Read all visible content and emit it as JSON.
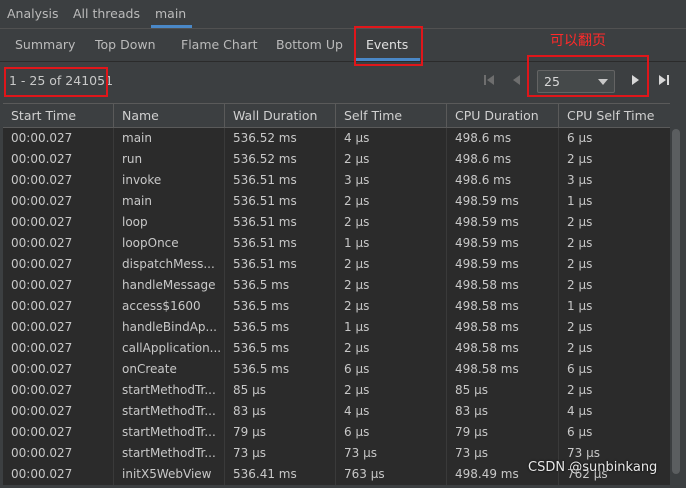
{
  "top_tabs": [
    "Analysis",
    "All threads",
    "main"
  ],
  "sub_tabs": [
    "Summary",
    "Top Down",
    "Flame Chart",
    "Bottom Up",
    "Events"
  ],
  "paging": {
    "range_label": "1 - 25 of 241051",
    "page_size": "25"
  },
  "annotation": {
    "text": "可以翻页",
    "color": "#e0161a"
  },
  "table": {
    "columns": [
      "Start Time",
      "Name",
      "Wall Duration",
      "Self Time",
      "CPU Duration",
      "CPU Self Time"
    ],
    "rows": [
      [
        "00:00.027",
        "main",
        "536.52 ms",
        "4 μs",
        "498.6 ms",
        "6 μs"
      ],
      [
        "00:00.027",
        "run",
        "536.52 ms",
        "2 μs",
        "498.6 ms",
        "2 μs"
      ],
      [
        "00:00.027",
        "invoke",
        "536.51 ms",
        "3 μs",
        "498.6 ms",
        "3 μs"
      ],
      [
        "00:00.027",
        "main",
        "536.51 ms",
        "2 μs",
        "498.59 ms",
        "1 μs"
      ],
      [
        "00:00.027",
        "loop",
        "536.51 ms",
        "2 μs",
        "498.59 ms",
        "2 μs"
      ],
      [
        "00:00.027",
        "loopOnce",
        "536.51 ms",
        "1 μs",
        "498.59 ms",
        "2 μs"
      ],
      [
        "00:00.027",
        "dispatchMess...",
        "536.51 ms",
        "2 μs",
        "498.59 ms",
        "2 μs"
      ],
      [
        "00:00.027",
        "handleMessage",
        "536.5 ms",
        "2 μs",
        "498.58 ms",
        "2 μs"
      ],
      [
        "00:00.027",
        "access$1600",
        "536.5 ms",
        "2 μs",
        "498.58 ms",
        "1 μs"
      ],
      [
        "00:00.027",
        "handleBindAp...",
        "536.5 ms",
        "1 μs",
        "498.58 ms",
        "2 μs"
      ],
      [
        "00:00.027",
        "callApplication...",
        "536.5 ms",
        "2 μs",
        "498.58 ms",
        "2 μs"
      ],
      [
        "00:00.027",
        "onCreate",
        "536.5 ms",
        "6 μs",
        "498.58 ms",
        "6 μs"
      ],
      [
        "00:00.027",
        "startMethodTr...",
        "85 μs",
        "2 μs",
        "85 μs",
        "2 μs"
      ],
      [
        "00:00.027",
        "startMethodTr...",
        "83 μs",
        "4 μs",
        "83 μs",
        "4 μs"
      ],
      [
        "00:00.027",
        "startMethodTr...",
        "79 μs",
        "6 μs",
        "79 μs",
        "6 μs"
      ],
      [
        "00:00.027",
        "startMethodTr...",
        "73 μs",
        "73 μs",
        "73 μs",
        "73 μs"
      ],
      [
        "00:00.027",
        "initX5WebView",
        "536.41 ms",
        "763 μs",
        "498.49 ms",
        "762 μs"
      ]
    ]
  },
  "watermark": "CSDN @sunbinkang",
  "colors": {
    "accent": "#4a88c7",
    "background": "#3c3f41",
    "row": "#2b2b2b"
  }
}
